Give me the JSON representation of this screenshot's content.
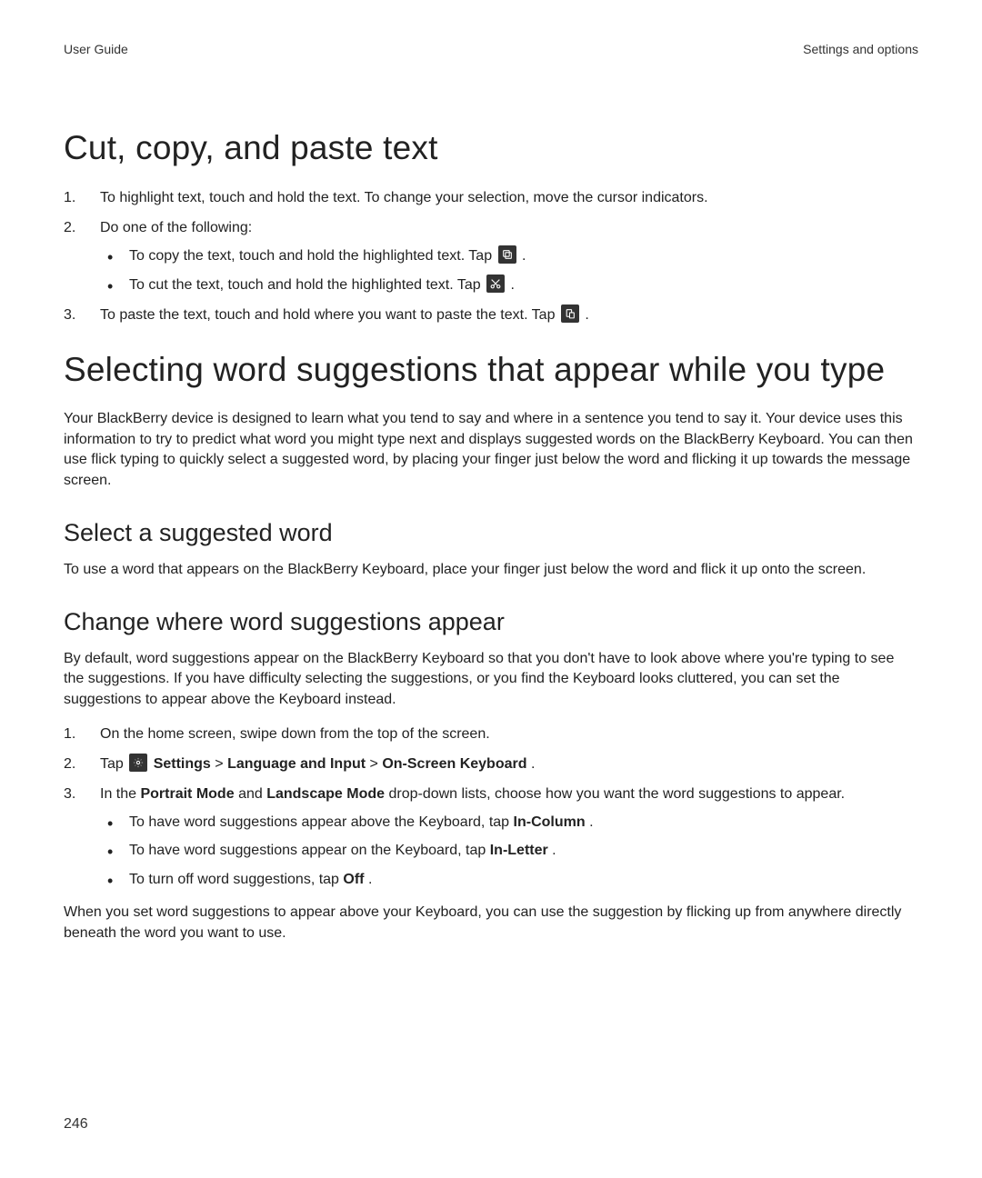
{
  "header": {
    "left": "User Guide",
    "right": "Settings and options"
  },
  "section1": {
    "title": "Cut, copy, and paste text",
    "steps": [
      {
        "text": "To highlight text, touch and hold the text. To change your selection, move the cursor indicators."
      },
      {
        "text": "Do one of the following:",
        "bullets": [
          {
            "pre": "To copy the text, touch and hold the highlighted text. Tap ",
            "icon": "copy-icon",
            "post": " ."
          },
          {
            "pre": "To cut the text, touch and hold the highlighted text. Tap ",
            "icon": "cut-icon",
            "post": " ."
          }
        ]
      },
      {
        "pre": "To paste the text, touch and hold where you want to paste the text. Tap ",
        "icon": "paste-icon",
        "post": " ."
      }
    ]
  },
  "section2": {
    "title": "Selecting word suggestions that appear while you type",
    "intro": "Your BlackBerry device is designed to learn what you tend to say and where in a sentence you tend to say it. Your device uses this information to try to predict what word you might type next and displays suggested words on the BlackBerry Keyboard. You can then use flick typing to quickly select a suggested word, by placing your finger just below the word and flicking it up towards the message screen.",
    "sub1": {
      "title": "Select a suggested word",
      "body": "To use a word that appears on the BlackBerry Keyboard, place your finger just below the word and flick it up onto the screen."
    },
    "sub2": {
      "title": "Change where word suggestions appear",
      "intro": "By default, word suggestions appear on the BlackBerry Keyboard so that you don't have to look above where you're typing to see the suggestions. If you have difficulty selecting the suggestions, or you find the Keyboard looks cluttered, you can set the suggestions to appear above the Keyboard instead.",
      "steps": {
        "s1": "On the home screen, swipe down from the top of the screen.",
        "s2": {
          "pre": "Tap ",
          "icon": "settings-icon",
          "nav": {
            "item1": "Settings",
            "sep1": " > ",
            "item2": "Language and Input",
            "sep2": " > ",
            "item3": "On-Screen Keyboard",
            "end": "."
          }
        },
        "s3": {
          "pre": "In the ",
          "b1": "Portrait Mode",
          "mid1": " and ",
          "b2": "Landscape Mode",
          "post": " drop-down lists, choose how you want the word suggestions to appear.",
          "bullets": {
            "a": {
              "pre": "To have word suggestions appear above the Keyboard, tap ",
              "b": "In-Column",
              "post": "."
            },
            "b": {
              "pre": "To have word suggestions appear on the Keyboard, tap ",
              "b": "In-Letter",
              "post": "."
            },
            "c": {
              "pre": "To turn off word suggestions, tap ",
              "b": "Off",
              "post": "."
            }
          }
        }
      },
      "outro": "When you set word suggestions to appear above your Keyboard, you can use the suggestion by flicking up from anywhere directly beneath the word you want to use."
    }
  },
  "page_number": "246"
}
